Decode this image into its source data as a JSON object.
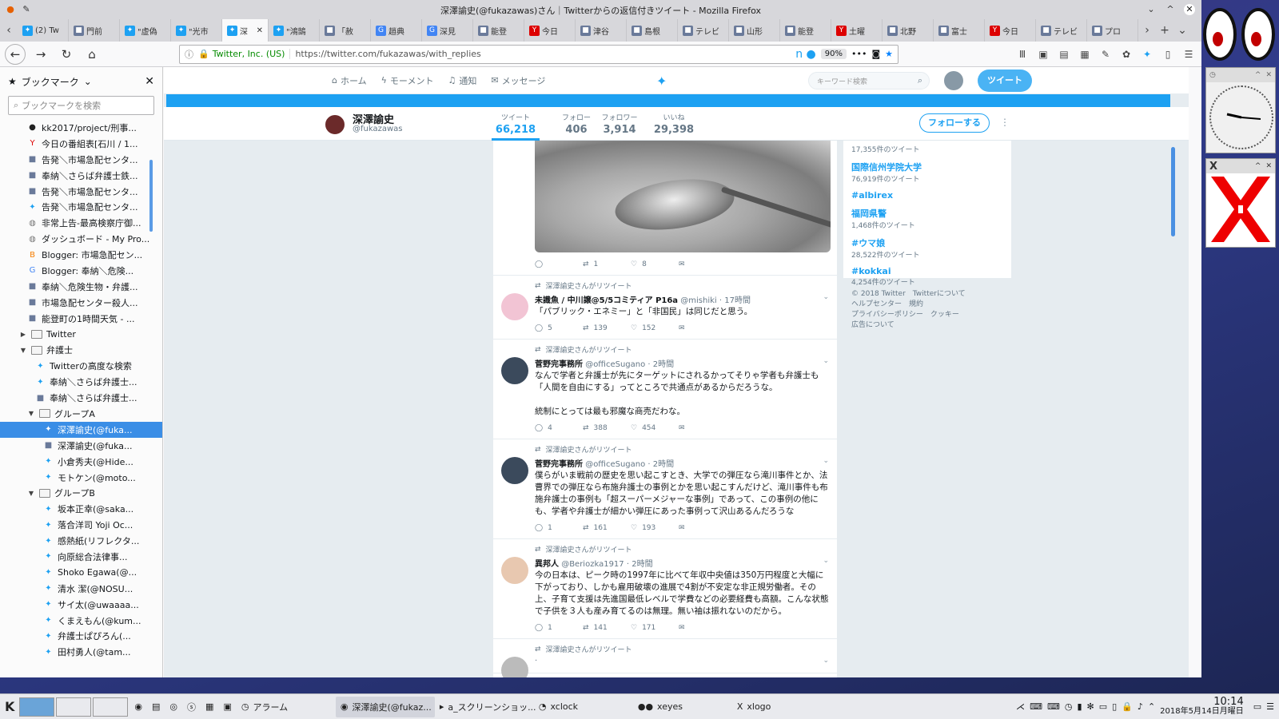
{
  "window": {
    "title": "深澤諭史(@fukazawas)さん｜Twitterからの返信付きツイート - Mozilla Firefox"
  },
  "tabs": [
    {
      "label": "(2) Tw",
      "icon": "twitter-icon"
    },
    {
      "label": "門前",
      "icon": "app-icon"
    },
    {
      "label": "\"虚偽",
      "icon": "twitter-icon"
    },
    {
      "label": "\"光市",
      "icon": "twitter-icon"
    },
    {
      "label": "深",
      "icon": "twitter-icon",
      "active": true
    },
    {
      "label": "\"鴻鵠",
      "icon": "twitter-icon"
    },
    {
      "label": "「赦",
      "icon": "app-icon"
    },
    {
      "label": "趙典",
      "icon": "google-icon"
    },
    {
      "label": "深見",
      "icon": "google-icon"
    },
    {
      "label": "能登",
      "icon": "app-icon"
    },
    {
      "label": "今日",
      "icon": "yahoo-icon"
    },
    {
      "label": "津谷",
      "icon": "app-icon"
    },
    {
      "label": "島根",
      "icon": "app-icon"
    },
    {
      "label": "テレビ",
      "icon": "app-icon"
    },
    {
      "label": "山形",
      "icon": "app-icon"
    },
    {
      "label": "能登",
      "icon": "app-icon"
    },
    {
      "label": "土曜",
      "icon": "yahoo-icon"
    },
    {
      "label": "北野",
      "icon": "app-icon"
    },
    {
      "label": "富士",
      "icon": "app-icon"
    },
    {
      "label": "今日",
      "icon": "yahoo-icon"
    },
    {
      "label": "テレビ",
      "icon": "app-icon"
    },
    {
      "label": "プロ",
      "icon": "app-icon"
    }
  ],
  "navbar": {
    "site_identity": "Twitter, Inc. (US)",
    "url": "https://twitter.com/fukazawas/with_replies",
    "zoom": "90%"
  },
  "sidebar": {
    "title": "ブックマーク",
    "search_placeholder": "ブックマークを検索",
    "items": [
      {
        "label": "kk2017/project/刑事...",
        "indent": 3,
        "icon": "github-icon"
      },
      {
        "label": "今日の番組表[石川 / 1...",
        "indent": 3,
        "icon": "yahoo-icon"
      },
      {
        "label": "告発＼市場急配センタ...",
        "indent": 3,
        "icon": "app-icon"
      },
      {
        "label": "奉納＼さらば弁護士鉄...",
        "indent": 3,
        "icon": "app-icon"
      },
      {
        "label": "告発＼市場急配センタ...",
        "indent": 3,
        "icon": "app-icon"
      },
      {
        "label": "告発＼市場急配センタ...",
        "indent": 3,
        "icon": "twitter-icon"
      },
      {
        "label": "非常上告-最高検察庁御...",
        "indent": 3,
        "icon": "globe-icon"
      },
      {
        "label": "ダッシュボード - My Pro...",
        "indent": 3,
        "icon": "globe-icon"
      },
      {
        "label": "Blogger: 市場急配セン...",
        "indent": 3,
        "icon": "blogger-icon"
      },
      {
        "label": "Blogger: 奉納＼危険...",
        "indent": 3,
        "icon": "google-icon"
      },
      {
        "label": "奉納＼危険生物・弁護...",
        "indent": 3,
        "icon": "app-icon"
      },
      {
        "label": "市場急配センター殺人...",
        "indent": 3,
        "icon": "app-icon"
      },
      {
        "label": "能登町の1時間天気 - ...",
        "indent": 3,
        "icon": "app-icon"
      },
      {
        "label": "Twitter",
        "indent": 2,
        "folder": true,
        "twist": "▶"
      },
      {
        "label": "弁護士",
        "indent": 2,
        "folder": true,
        "twist": "▼"
      },
      {
        "label": "Twitterの高度な検索",
        "indent": 4,
        "icon": "twitter-icon"
      },
      {
        "label": "奉納＼さらば弁護士...",
        "indent": 4,
        "icon": "twitter-icon"
      },
      {
        "label": "奉納＼さらば弁護士...",
        "indent": 4,
        "icon": "app-icon"
      },
      {
        "label": "グループA",
        "indent": 3,
        "folder": true,
        "twist": "▼"
      },
      {
        "label": "深澤諭史(@fuka...",
        "indent": 5,
        "icon": "twitter-icon",
        "selected": true
      },
      {
        "label": "深澤諭史(@fuka...",
        "indent": 5,
        "icon": "app-icon"
      },
      {
        "label": "小倉秀夫(@Hide...",
        "indent": 5,
        "icon": "twitter-icon"
      },
      {
        "label": "モトケン(@moto...",
        "indent": 5,
        "icon": "twitter-icon"
      },
      {
        "label": "グループB",
        "indent": 3,
        "folder": true,
        "twist": "▼"
      },
      {
        "label": "坂本正幸(@saka...",
        "indent": 5,
        "icon": "twitter-icon"
      },
      {
        "label": "落合洋司 Yoji Oc...",
        "indent": 5,
        "icon": "twitter-icon"
      },
      {
        "label": "感熱紙(リフレクタ...",
        "indent": 5,
        "icon": "twitter-icon"
      },
      {
        "label": "向原総合法律事...",
        "indent": 5,
        "icon": "twitter-icon"
      },
      {
        "label": "Shoko Egawa(@...",
        "indent": 5,
        "icon": "twitter-icon"
      },
      {
        "label": "清水 潔(@NOSU...",
        "indent": 5,
        "icon": "twitter-icon"
      },
      {
        "label": "サイ太(@uwaaaa...",
        "indent": 5,
        "icon": "twitter-icon"
      },
      {
        "label": "くまえもん(@kum...",
        "indent": 5,
        "icon": "twitter-icon"
      },
      {
        "label": "弁護士ぱぴろん(...",
        "indent": 5,
        "icon": "twitter-icon"
      },
      {
        "label": "田村勇人(@tam...",
        "indent": 5,
        "icon": "twitter-icon"
      }
    ]
  },
  "twitter": {
    "nav": {
      "home": "ホーム",
      "moments": "モーメント",
      "notifications": "通知",
      "messages": "メッセージ"
    },
    "search_placeholder": "キーワード検索",
    "tweet_button": "ツイート",
    "profile": {
      "name": "深澤諭史",
      "handle": "@fukazawas",
      "stats": [
        {
          "label": "ツイート",
          "value": "66,218",
          "active": true
        },
        {
          "label": "フォロー",
          "value": "406"
        },
        {
          "label": "フォロワー",
          "value": "3,914"
        },
        {
          "label": "いいね",
          "value": "29,398"
        }
      ],
      "follow_button": "フォローする"
    },
    "media_actions": {
      "reply": "",
      "retweet": "1",
      "like": "8"
    },
    "tweets": [
      {
        "retweet_label": "深澤諭史さんがリツイート",
        "name": "未識魚 / 中川譲@5/5コミティア P16a",
        "handle": "@mishiki",
        "time": "17時間",
        "text": "「パブリック・エネミー」と「非国民」は同じだと思う。",
        "reply": "5",
        "retweet": "139",
        "like": "152"
      },
      {
        "retweet_label": "深澤諭史さんがリツイート",
        "name": "菅野完事務所",
        "handle": "@officeSugano",
        "time": "2時間",
        "text": "なんで学者と弁護士が先にターゲットにされるかってそりゃ学者も弁護士も「人間を自由にする」ってところで共通点があるからだろうな。\n\n統制にとっては最も邪魔な商売だわな。",
        "reply": "4",
        "retweet": "388",
        "like": "454"
      },
      {
        "retweet_label": "深澤諭史さんがリツイート",
        "name": "菅野完事務所",
        "handle": "@officeSugano",
        "time": "2時間",
        "text": "僕らがいま戦前の歴史を思い起こすとき、大学での弾圧なら滝川事件とか、法曹界での弾圧なら布施弁護士の事例とかを思い起こすんだけど、滝川事件も布施弁護士の事例も「超スーパーメジャーな事例」であって、この事例の他にも、学者や弁護士が細かい弾圧にあった事例って沢山あるんだろうな",
        "reply": "1",
        "retweet": "161",
        "like": "193"
      },
      {
        "retweet_label": "深澤諭史さんがリツイート",
        "name": "異邦人",
        "handle": "@Beriozka1917",
        "time": "2時間",
        "text": "今の日本は、ピーク時の1997年に比べて年収中央値は350万円程度と大幅に下がっており、しかも雇用破壊の進展で4割が不安定な非正規労働者。その上、子育て支援は先進国最低レベルで学費などの必要経費も高額。こんな状態で子供を３人も産み育てるのは無理。無い袖は振れないのだから。",
        "reply": "1",
        "retweet": "141",
        "like": "171"
      },
      {
        "retweet_label": "深澤諭史さんがリツイート",
        "name": "",
        "handle": "",
        "time": "",
        "text": "",
        "reply": "",
        "retweet": "",
        "like": ""
      }
    ],
    "trends": [
      {
        "name": "",
        "count": "17,355件のツイート"
      },
      {
        "name": "国際信州学院大学",
        "count": "76,919件のツイート"
      },
      {
        "name": "#albirex",
        "count": ""
      },
      {
        "name": "福岡県警",
        "count": "1,468件のツイート"
      },
      {
        "name": "#ウマ娘",
        "count": "28,522件のツイート"
      },
      {
        "name": "#kokkai",
        "count": "4,254件のツイート"
      }
    ],
    "footer": {
      "line1": "© 2018 Twitter　Twitterについて",
      "line2": "ヘルプセンター　規約",
      "line3": "プライバシーポリシー　クッキー",
      "line4": "広告について"
    }
  },
  "taskbar": {
    "items": [
      {
        "label": "アラーム",
        "icon": "alarm-icon"
      },
      {
        "label": "深澤諭史(@fukaz...",
        "icon": "firefox-icon",
        "active": true
      },
      {
        "label": "a_スクリーンショッ...",
        "icon": "terminal-icon"
      },
      {
        "label": "xclock",
        "icon": "clock-icon"
      },
      {
        "label": "xeyes",
        "icon": "eyes-icon"
      },
      {
        "label": "xlogo",
        "icon": "x-icon"
      }
    ],
    "time": "10:14",
    "date": "2018年5月14日月曜日"
  }
}
